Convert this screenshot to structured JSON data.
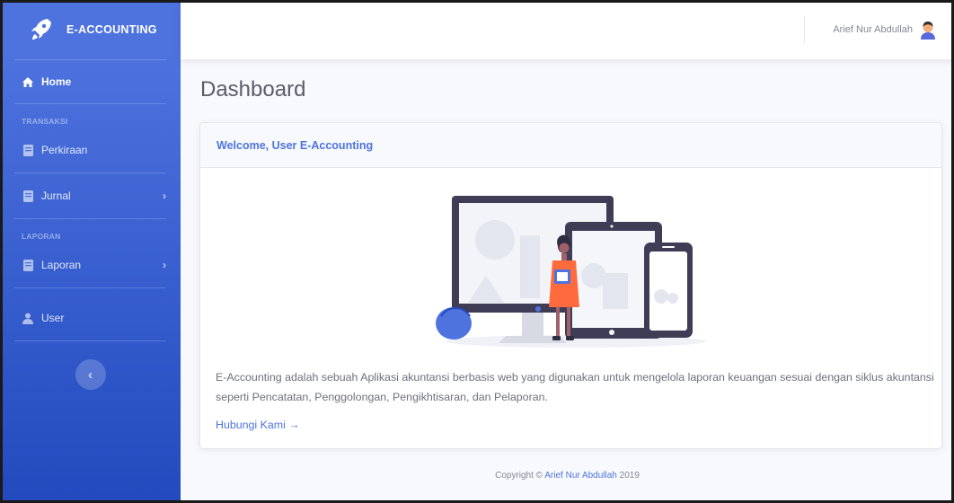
{
  "sidebar": {
    "brand": "E-ACCOUNTING",
    "brand_icon": "rocket-icon",
    "items": [
      {
        "label": "Home",
        "icon": "home-icon",
        "active": true
      },
      {
        "heading": "TRANSAKSI"
      },
      {
        "label": "Perkiraan",
        "icon": "book-icon"
      },
      {
        "label": "Jurnal",
        "icon": "book-icon",
        "has_submenu": true
      },
      {
        "heading": "LAPORAN"
      },
      {
        "label": "Laporan",
        "icon": "book-icon",
        "has_submenu": true
      },
      {
        "label": "User",
        "icon": "user-icon"
      }
    ],
    "toggle_glyph": "‹"
  },
  "topbar": {
    "user_name": "Arief Nur Abdullah",
    "avatar_icon": "user-avatar-icon"
  },
  "main": {
    "page_title": "Dashboard",
    "card": {
      "title": "Welcome, User E-Accounting",
      "description": "E-Accounting adalah sebuah Aplikasi akuntansi berbasis web yang digunakan untuk mengelola laporan keuangan sesuai dengan siklus akuntansi seperti Pencatatan, Penggolongan, Pengikhtisaran, dan Pelaporan.",
      "link_label": "Hubungi Kami →"
    }
  },
  "footer": {
    "prefix": "Copyright © ",
    "author": "Arief Nur Abdullah",
    "year": " 2019"
  },
  "colors": {
    "primary": "#4e73df",
    "sidebar_gradient_end": "#224abe",
    "text": "#858796"
  }
}
